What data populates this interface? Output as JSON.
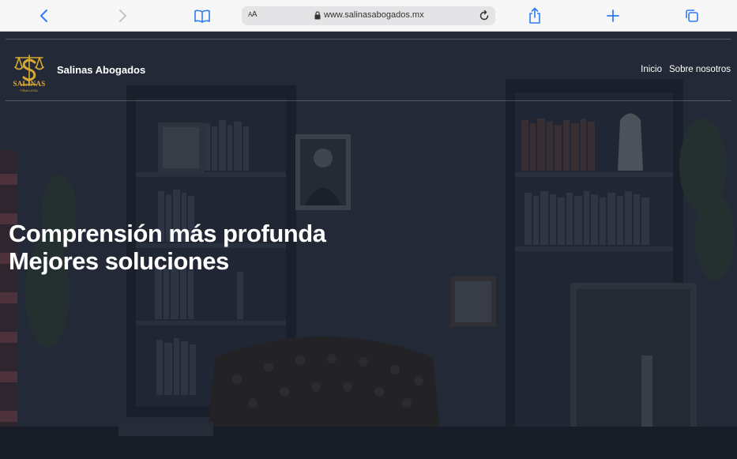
{
  "browser": {
    "url": "www.salinasabogados.mx",
    "reader_label": "AA",
    "accent": "#2f7bf5",
    "icons": [
      "back-icon",
      "forward-icon",
      "bookmarks-icon",
      "lock-icon",
      "reload-icon",
      "share-icon",
      "new-tab-icon",
      "tabs-icon"
    ]
  },
  "site": {
    "logo_text": "SALINAS",
    "logo_subtext": "FIRMA LEGAL",
    "brand_name": "Salinas Abogados",
    "brand_color": "#d8a930",
    "nav": [
      {
        "label": "Inicio"
      },
      {
        "label": "Sobre nosotros"
      }
    ],
    "hero": {
      "line1": "Comprensión más profunda",
      "line2": "Mejores soluciones"
    }
  }
}
